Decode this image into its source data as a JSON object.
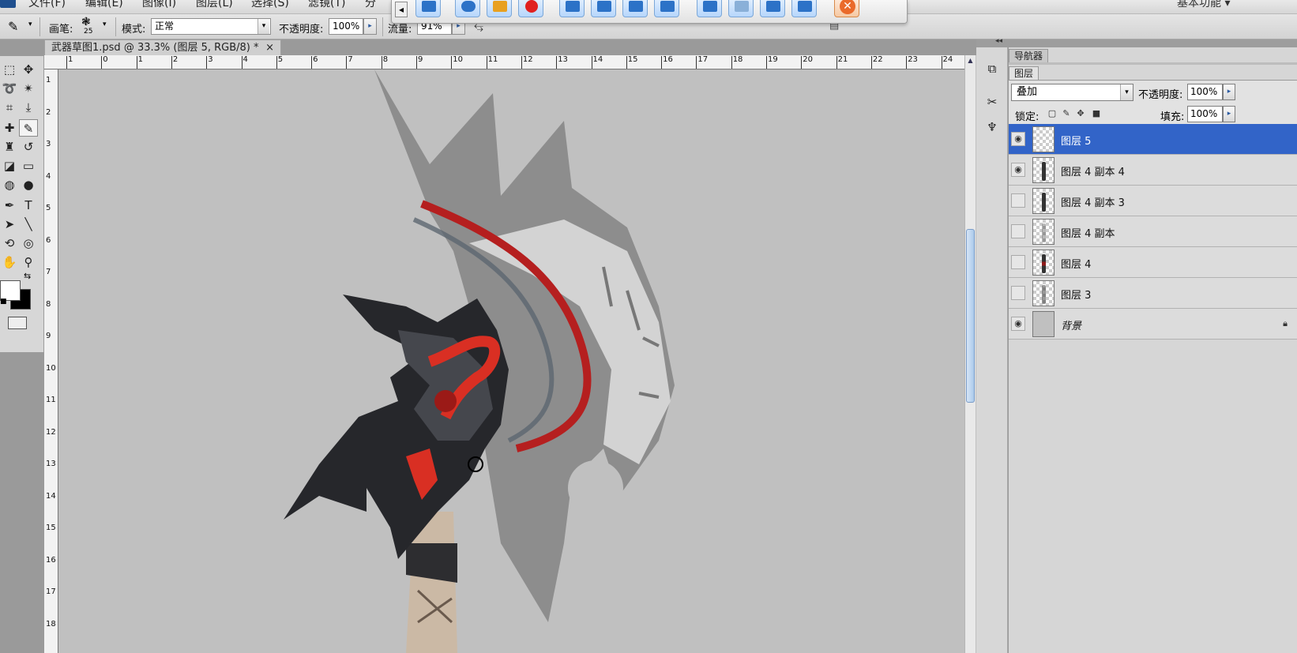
{
  "menubar": {
    "items": [
      "文件(F)",
      "编辑(E)",
      "图像(I)",
      "图层(L)",
      "选择(S)",
      "滤镜(T)",
      "分"
    ],
    "workspace": "基本功能 ▾"
  },
  "options": {
    "brush_label": "画笔:",
    "brush_size": "25",
    "mode_label": "模式:",
    "mode_value": "正常",
    "opacity_label": "不透明度:",
    "opacity_value": "100%",
    "flow_label": "流量:",
    "flow_value": "91%"
  },
  "document": {
    "tab_title": "武器草图1.psd @ 33.3% (图层 5, RGB/8) *",
    "close_glyph": "×"
  },
  "ruler": {
    "h_ticks": [
      "1",
      "0",
      "1",
      "2",
      "3",
      "4",
      "5",
      "6",
      "7",
      "8",
      "9",
      "10",
      "11",
      "12",
      "13",
      "14",
      "15",
      "16",
      "17",
      "18",
      "19",
      "20",
      "21",
      "22",
      "23",
      "24"
    ],
    "v_ticks": [
      "1",
      "2",
      "3",
      "4",
      "5",
      "6",
      "7",
      "8",
      "9",
      "10",
      "11",
      "12",
      "13",
      "14",
      "15",
      "16",
      "17",
      "18"
    ]
  },
  "panels": {
    "navigator_tab": "导航器",
    "layers_tab": "图层",
    "blend_mode": "叠加",
    "opacity_label": "不透明度:",
    "opacity_value": "100%",
    "lock_label": "锁定:",
    "fill_label": "填充:",
    "fill_value": "100%"
  },
  "layers": [
    {
      "name": "图层 5",
      "visible": true,
      "selected": true,
      "thumb": "empty"
    },
    {
      "name": "图层 4 副本 4",
      "visible": true,
      "selected": false,
      "thumb": "figure"
    },
    {
      "name": "图层 4 副本 3",
      "visible": false,
      "selected": false,
      "thumb": "figure"
    },
    {
      "name": "图层 4 副本",
      "visible": false,
      "selected": false,
      "thumb": "figure"
    },
    {
      "name": "图层 4",
      "visible": false,
      "selected": false,
      "thumb": "figure-red"
    },
    {
      "name": "图层 3",
      "visible": false,
      "selected": false,
      "thumb": "figure"
    },
    {
      "name": "背景",
      "visible": true,
      "selected": false,
      "thumb": "solid",
      "locked": true
    }
  ],
  "colors": {
    "selection_blue": "#3264c8",
    "canvas_gray": "#c0c0c0",
    "accent_red": "#b51f1f"
  }
}
